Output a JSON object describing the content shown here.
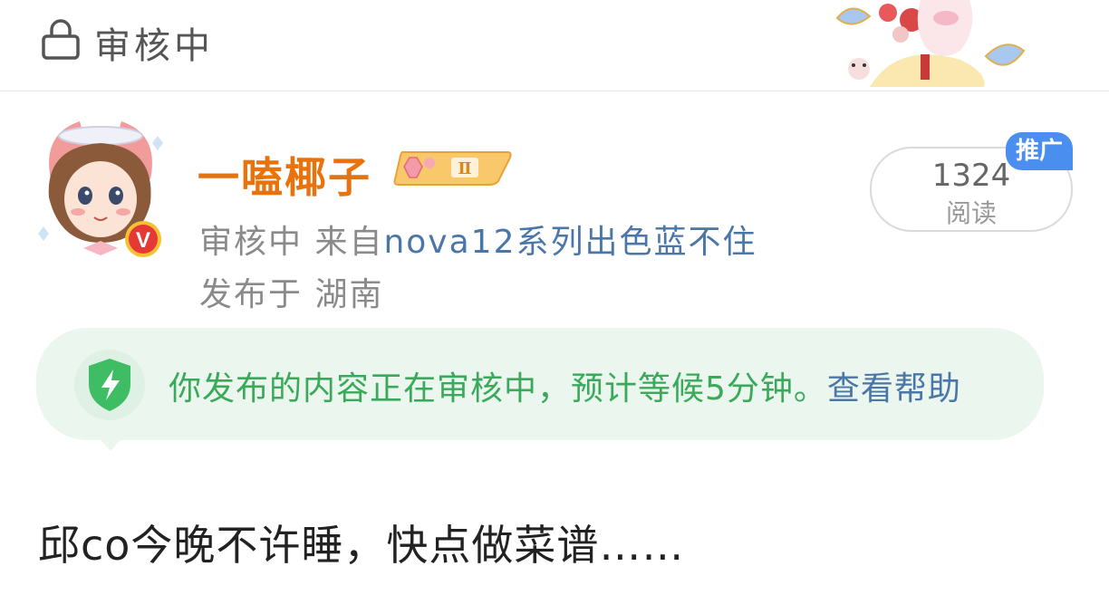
{
  "header": {
    "status_title": "审核中"
  },
  "author": {
    "name": "一嗑椰子",
    "level_badge": "Ⅱ",
    "verified_badge": "V",
    "status_prefix": "审核中 来自",
    "device": "nova12系列出色蓝不住",
    "location": "发布于 湖南"
  },
  "read_stats": {
    "count": "1324",
    "label": "阅读",
    "promo_badge": "推广"
  },
  "notice": {
    "message": "你发布的内容正在审核中，预计等候5分钟。",
    "help_link": "查看帮助"
  },
  "post": {
    "title": "邱co今晚不许睡，快点做菜谱……"
  },
  "colors": {
    "author_name": "#e8730c",
    "notice_bg": "#ebf6ee",
    "notice_text": "#3aa95a",
    "link": "#4a76a8",
    "promo": "#4a8ef0"
  }
}
